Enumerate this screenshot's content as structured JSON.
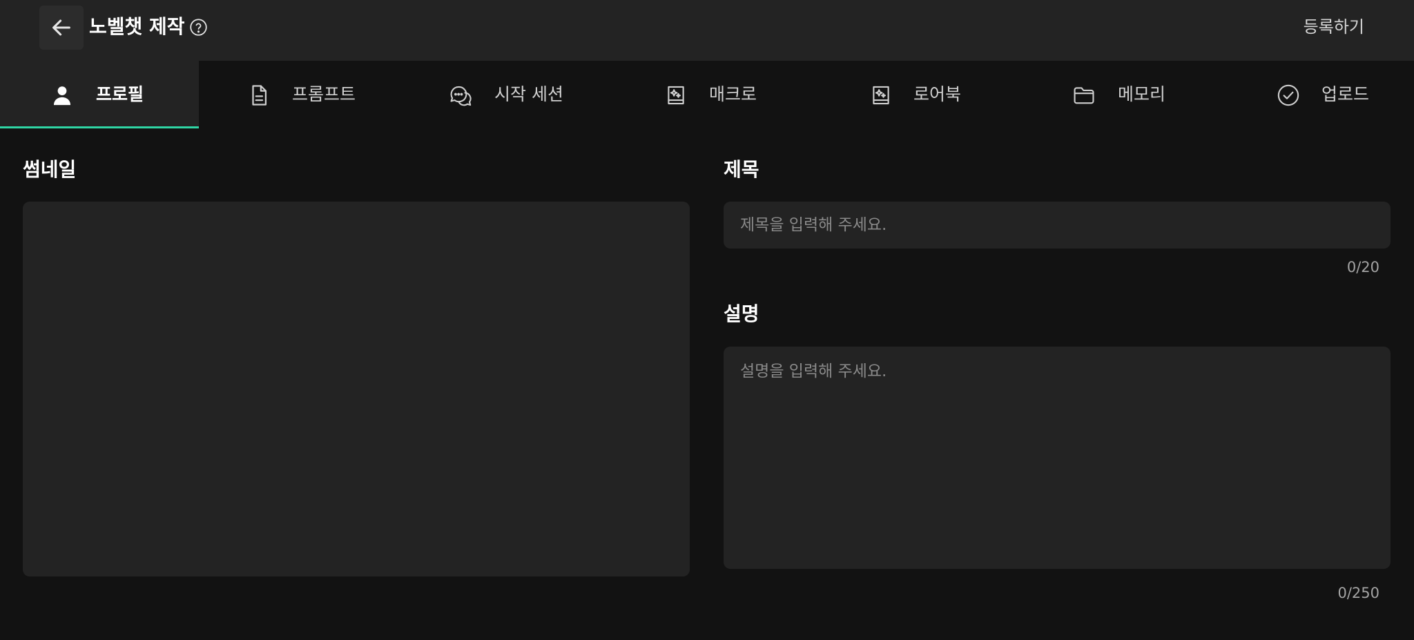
{
  "header": {
    "title": "노벨챗 제작",
    "register_label": "등록하기",
    "icons": {
      "back": "arrow-left-icon",
      "help": "question-circle-icon"
    }
  },
  "tabs": [
    {
      "label": "프로필",
      "icon": "user-icon",
      "active": true
    },
    {
      "label": "프롬프트",
      "icon": "document-icon",
      "active": false
    },
    {
      "label": "시작 세션",
      "icon": "chat-bubbles-icon",
      "active": false
    },
    {
      "label": "매크로",
      "icon": "sparkle-book-icon",
      "active": false
    },
    {
      "label": "로어북",
      "icon": "sparkle-book-icon",
      "active": false
    },
    {
      "label": "메모리",
      "icon": "folder-icon",
      "active": false
    },
    {
      "label": "업로드",
      "icon": "check-circle-icon",
      "active": false
    }
  ],
  "thumbnail": {
    "label": "썸네일"
  },
  "title_field": {
    "label": "제목",
    "placeholder": "제목을 입력해 주세요.",
    "value": "",
    "counter": "0/20"
  },
  "description_field": {
    "label": "설명",
    "placeholder": "설명을 입력해 주세요.",
    "value": "",
    "counter": "0/250"
  },
  "colors": {
    "accent": "#2fd6a5",
    "background": "#121212",
    "surface": "#232323"
  }
}
